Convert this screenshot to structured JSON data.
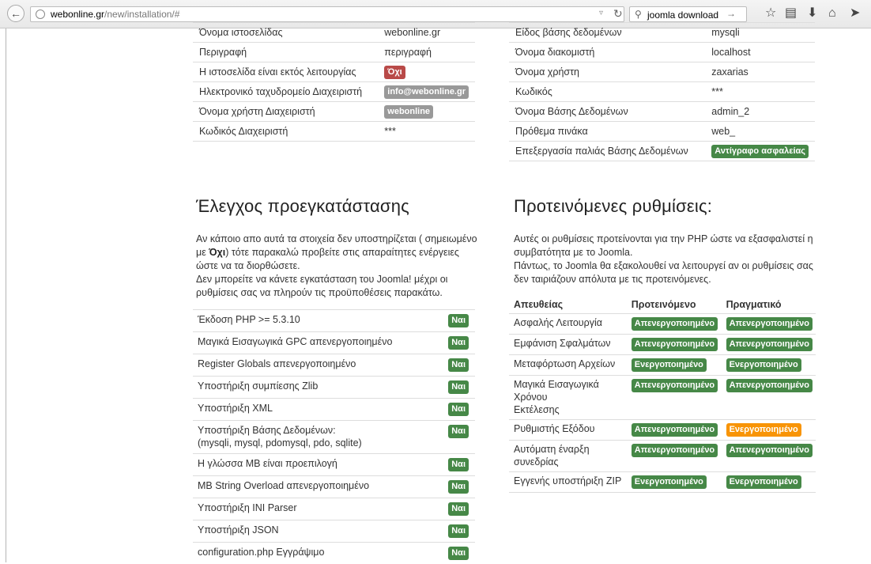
{
  "browser": {
    "url_host": "webonline.gr",
    "url_path": "/new/installation/#",
    "search_text": "joomla download"
  },
  "site_config": {
    "rows": [
      {
        "label": "Όνομα ιστοσελίδας",
        "value": "webonline.gr",
        "type": "text"
      },
      {
        "label": "Περιγραφή",
        "value": "περιγραφή",
        "type": "text"
      },
      {
        "label": "Η ιστοσελίδα είναι εκτός λειτουργίας",
        "value": "Όχι",
        "type": "danger"
      },
      {
        "label": "Ηλεκτρονικό ταχυδρομείο Διαχειριστή",
        "value": "info@webonline.gr",
        "type": "default"
      },
      {
        "label": "Όνομα χρήστη Διαχειριστή",
        "value": "webonline",
        "type": "default"
      },
      {
        "label": "Κωδικός Διαχειριστή",
        "value": "***",
        "type": "text"
      }
    ]
  },
  "db_config": {
    "rows": [
      {
        "label": "Είδος βάσης δεδομένων",
        "value": "mysqli",
        "type": "text"
      },
      {
        "label": "Όνομα διακομιστή",
        "value": "localhost",
        "type": "text"
      },
      {
        "label": "Όνομα χρήστη",
        "value": "zaxarias",
        "type": "text"
      },
      {
        "label": "Κωδικός",
        "value": "***",
        "type": "text"
      },
      {
        "label": "Όνομα Βάσης Δεδομένων",
        "value": "admin_2",
        "type": "text"
      },
      {
        "label": "Πρόθεμα πινάκα",
        "value": "web_",
        "type": "text"
      },
      {
        "label": "Επεξεργασία παλιάς Βάσης Δεδομένων",
        "value": "Αντίγραφο ασφαλείας",
        "type": "success"
      }
    ]
  },
  "precheck": {
    "title": "Έλεγχος προεγκατάστασης",
    "intro_part1": "Αν κάποιο απο αυτά τα στοιχεία δεν υποστηρίζεται ( σημειωμένο με ",
    "intro_bold": "Όχι",
    "intro_part2": ") τότε παρακαλώ προβείτε στις απαραίτητες ενέργειες ώστε να τα διορθώσετε.",
    "intro_line2": "Δεν μπορείτε να κάνετε εγκατάσταση του Joomla! μέχρι οι ρυθμίσεις σας να πληρούν τις προϋποθέσεις παρακάτω.",
    "items": [
      {
        "label": "Έκδοση PHP >= 5.3.10",
        "label2": "",
        "status": "Ναι"
      },
      {
        "label": "Μαγικά Εισαγωγικά GPC απενεργοποιημένο",
        "label2": "",
        "status": "Ναι"
      },
      {
        "label": "Register Globals απενεργοποιημένο",
        "label2": "",
        "status": "Ναι"
      },
      {
        "label": "Υποστήριξη συμπίεσης Zlib",
        "label2": "",
        "status": "Ναι"
      },
      {
        "label": "Υποστήριξη XML",
        "label2": "",
        "status": "Ναι"
      },
      {
        "label": "Υποστήριξη Βάσης Δεδομένων:",
        "label2": "(mysqli, mysql, pdomysql, pdo, sqlite)",
        "status": "Ναι"
      },
      {
        "label": "Η γλώσσα MB είναι προεπιλογή",
        "label2": "",
        "status": "Ναι"
      },
      {
        "label": "MB String Overload απενεργοποιημένο",
        "label2": "",
        "status": "Ναι"
      },
      {
        "label": "Υποστήριξη INI Parser",
        "label2": "",
        "status": "Ναι"
      },
      {
        "label": "Υποστήριξη JSON",
        "label2": "",
        "status": "Ναι"
      },
      {
        "label": "configuration.php Εγγράψιμο",
        "label2": "",
        "status": "Ναι"
      }
    ]
  },
  "recommended": {
    "title": "Προτεινόμενες ρυθμίσεις:",
    "intro1": "Αυτές οι ρυθμίσεις προτείνονται για την PHP ώστε να εξασφαλιστεί η συμβατότητα με το Joomla.",
    "intro2": "Πάντως, το Joomla θα εξακολουθεί να λειτουργεί αν οι ρυθμίσεις σας δεν ταιριάζουν απόλυτα με τις προτεινόμενες.",
    "headers": [
      "Απευθείας",
      "Προτεινόμενο",
      "Πραγματικό"
    ],
    "rows": [
      {
        "name": "Ασφαλής Λειτουργία",
        "name2": "",
        "recommended": "Απενεργοποιημένο",
        "actual": "Απενεργοποιημένο",
        "actual_type": "success"
      },
      {
        "name": "Εμφάνιση Σφαλμάτων",
        "name2": "",
        "recommended": "Απενεργοποιημένο",
        "actual": "Απενεργοποιημένο",
        "actual_type": "success"
      },
      {
        "name": "Μεταφόρτωση Αρχείων",
        "name2": "",
        "recommended": "Ενεργοποιημένο",
        "actual": "Ενεργοποιημένο",
        "actual_type": "success"
      },
      {
        "name": "Μαγικά Εισαγωγικά Χρόνου",
        "name2": "Εκτέλεσης",
        "recommended": "Απενεργοποιημένο",
        "actual": "Απενεργοποιημένο",
        "actual_type": "success"
      },
      {
        "name": "Ρυθμιστής Εξόδου",
        "name2": "",
        "recommended": "Απενεργοποιημένο",
        "actual": "Ενεργοποιημένο",
        "actual_type": "warning"
      },
      {
        "name": "Αυτόματη έναρξη συνεδρίας",
        "name2": "",
        "recommended": "Απενεργοποιημένο",
        "actual": "Απενεργοποιημένο",
        "actual_type": "success"
      },
      {
        "name": "Εγγενής υποστήριξη ZIP",
        "name2": "",
        "recommended": "Ενεργοποιημένο",
        "actual": "Ενεργοποιημένο",
        "actual_type": "success"
      }
    ]
  }
}
